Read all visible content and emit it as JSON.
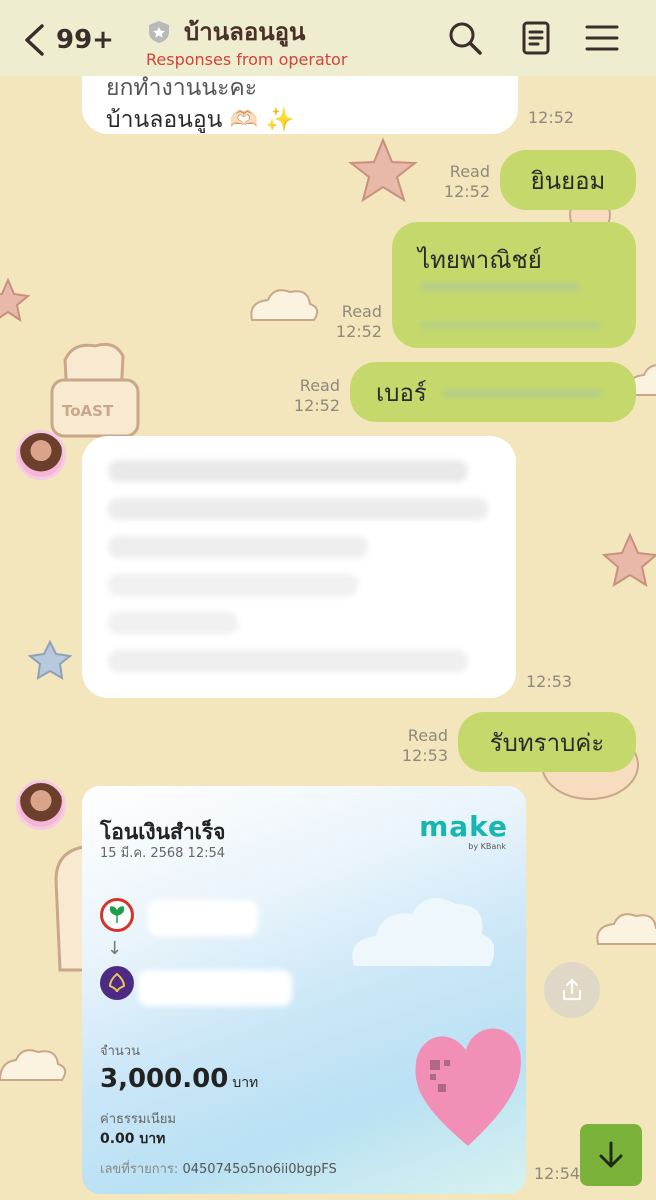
{
  "header": {
    "unread_count": "99+",
    "title": "บ้านลอนอูน",
    "subtitle": "Responses from operator"
  },
  "messages": [
    {
      "id": "m1",
      "dir": "in",
      "lines": [
        "ยกทำงานนะคะ",
        "บ้านลอนอูน 🫶🏻 ✨"
      ],
      "time": "12:52"
    },
    {
      "id": "m2",
      "dir": "out",
      "text": "ยินยอม",
      "read": "Read",
      "time": "12:52"
    },
    {
      "id": "m3",
      "dir": "out",
      "text": "ไทยพาณิชย์",
      "read": "Read",
      "time": "12:52"
    },
    {
      "id": "m4",
      "dir": "out",
      "text": "เบอร์",
      "read": "Read",
      "time": "12:52"
    },
    {
      "id": "m5",
      "dir": "in",
      "time": "12:53"
    },
    {
      "id": "m6",
      "dir": "out",
      "text": "รับทราบค่ะ",
      "read": "Read",
      "time": "12:53"
    }
  ],
  "slip": {
    "title": "โอนเงินสำเร็จ",
    "datetime": "15 มี.ค. 2568 12:54",
    "brand": "make",
    "brand_sub": "by KBank",
    "amount_label": "จำนวน",
    "amount": "3,000.00",
    "currency": "บาท",
    "fee_label": "ค่าธรรมเนียม",
    "fee": "0.00 บาท",
    "ref_label": "เลขที่รายการ:",
    "ref": "0450745o5no6ii0bgpFS",
    "time": "12:54"
  },
  "colors": {
    "header_bg": "#efedcf",
    "wallpaper": "#f3e6bd",
    "outgoing_bubble": "#c5d86c",
    "incoming_bubble": "#ffffff",
    "subtitle": "#d6423a",
    "scroll_button": "#7bb23a"
  },
  "icons": [
    "back-chevron-icon",
    "shield-icon",
    "search-icon",
    "notes-icon",
    "menu-icon",
    "share-icon",
    "arrow-down-icon"
  ]
}
